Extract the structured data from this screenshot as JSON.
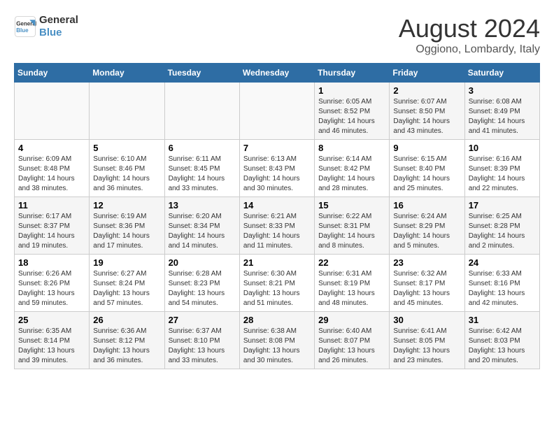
{
  "header": {
    "logo_line1": "General",
    "logo_line2": "Blue",
    "month_title": "August 2024",
    "location": "Oggiono, Lombardy, Italy"
  },
  "weekdays": [
    "Sunday",
    "Monday",
    "Tuesday",
    "Wednesday",
    "Thursday",
    "Friday",
    "Saturday"
  ],
  "weeks": [
    [
      {
        "day": "",
        "info": ""
      },
      {
        "day": "",
        "info": ""
      },
      {
        "day": "",
        "info": ""
      },
      {
        "day": "",
        "info": ""
      },
      {
        "day": "1",
        "info": "Sunrise: 6:05 AM\nSunset: 8:52 PM\nDaylight: 14 hours\nand 46 minutes."
      },
      {
        "day": "2",
        "info": "Sunrise: 6:07 AM\nSunset: 8:50 PM\nDaylight: 14 hours\nand 43 minutes."
      },
      {
        "day": "3",
        "info": "Sunrise: 6:08 AM\nSunset: 8:49 PM\nDaylight: 14 hours\nand 41 minutes."
      }
    ],
    [
      {
        "day": "4",
        "info": "Sunrise: 6:09 AM\nSunset: 8:48 PM\nDaylight: 14 hours\nand 38 minutes."
      },
      {
        "day": "5",
        "info": "Sunrise: 6:10 AM\nSunset: 8:46 PM\nDaylight: 14 hours\nand 36 minutes."
      },
      {
        "day": "6",
        "info": "Sunrise: 6:11 AM\nSunset: 8:45 PM\nDaylight: 14 hours\nand 33 minutes."
      },
      {
        "day": "7",
        "info": "Sunrise: 6:13 AM\nSunset: 8:43 PM\nDaylight: 14 hours\nand 30 minutes."
      },
      {
        "day": "8",
        "info": "Sunrise: 6:14 AM\nSunset: 8:42 PM\nDaylight: 14 hours\nand 28 minutes."
      },
      {
        "day": "9",
        "info": "Sunrise: 6:15 AM\nSunset: 8:40 PM\nDaylight: 14 hours\nand 25 minutes."
      },
      {
        "day": "10",
        "info": "Sunrise: 6:16 AM\nSunset: 8:39 PM\nDaylight: 14 hours\nand 22 minutes."
      }
    ],
    [
      {
        "day": "11",
        "info": "Sunrise: 6:17 AM\nSunset: 8:37 PM\nDaylight: 14 hours\nand 19 minutes."
      },
      {
        "day": "12",
        "info": "Sunrise: 6:19 AM\nSunset: 8:36 PM\nDaylight: 14 hours\nand 17 minutes."
      },
      {
        "day": "13",
        "info": "Sunrise: 6:20 AM\nSunset: 8:34 PM\nDaylight: 14 hours\nand 14 minutes."
      },
      {
        "day": "14",
        "info": "Sunrise: 6:21 AM\nSunset: 8:33 PM\nDaylight: 14 hours\nand 11 minutes."
      },
      {
        "day": "15",
        "info": "Sunrise: 6:22 AM\nSunset: 8:31 PM\nDaylight: 14 hours\nand 8 minutes."
      },
      {
        "day": "16",
        "info": "Sunrise: 6:24 AM\nSunset: 8:29 PM\nDaylight: 14 hours\nand 5 minutes."
      },
      {
        "day": "17",
        "info": "Sunrise: 6:25 AM\nSunset: 8:28 PM\nDaylight: 14 hours\nand 2 minutes."
      }
    ],
    [
      {
        "day": "18",
        "info": "Sunrise: 6:26 AM\nSunset: 8:26 PM\nDaylight: 13 hours\nand 59 minutes."
      },
      {
        "day": "19",
        "info": "Sunrise: 6:27 AM\nSunset: 8:24 PM\nDaylight: 13 hours\nand 57 minutes."
      },
      {
        "day": "20",
        "info": "Sunrise: 6:28 AM\nSunset: 8:23 PM\nDaylight: 13 hours\nand 54 minutes."
      },
      {
        "day": "21",
        "info": "Sunrise: 6:30 AM\nSunset: 8:21 PM\nDaylight: 13 hours\nand 51 minutes."
      },
      {
        "day": "22",
        "info": "Sunrise: 6:31 AM\nSunset: 8:19 PM\nDaylight: 13 hours\nand 48 minutes."
      },
      {
        "day": "23",
        "info": "Sunrise: 6:32 AM\nSunset: 8:17 PM\nDaylight: 13 hours\nand 45 minutes."
      },
      {
        "day": "24",
        "info": "Sunrise: 6:33 AM\nSunset: 8:16 PM\nDaylight: 13 hours\nand 42 minutes."
      }
    ],
    [
      {
        "day": "25",
        "info": "Sunrise: 6:35 AM\nSunset: 8:14 PM\nDaylight: 13 hours\nand 39 minutes."
      },
      {
        "day": "26",
        "info": "Sunrise: 6:36 AM\nSunset: 8:12 PM\nDaylight: 13 hours\nand 36 minutes."
      },
      {
        "day": "27",
        "info": "Sunrise: 6:37 AM\nSunset: 8:10 PM\nDaylight: 13 hours\nand 33 minutes."
      },
      {
        "day": "28",
        "info": "Sunrise: 6:38 AM\nSunset: 8:08 PM\nDaylight: 13 hours\nand 30 minutes."
      },
      {
        "day": "29",
        "info": "Sunrise: 6:40 AM\nSunset: 8:07 PM\nDaylight: 13 hours\nand 26 minutes."
      },
      {
        "day": "30",
        "info": "Sunrise: 6:41 AM\nSunset: 8:05 PM\nDaylight: 13 hours\nand 23 minutes."
      },
      {
        "day": "31",
        "info": "Sunrise: 6:42 AM\nSunset: 8:03 PM\nDaylight: 13 hours\nand 20 minutes."
      }
    ]
  ]
}
